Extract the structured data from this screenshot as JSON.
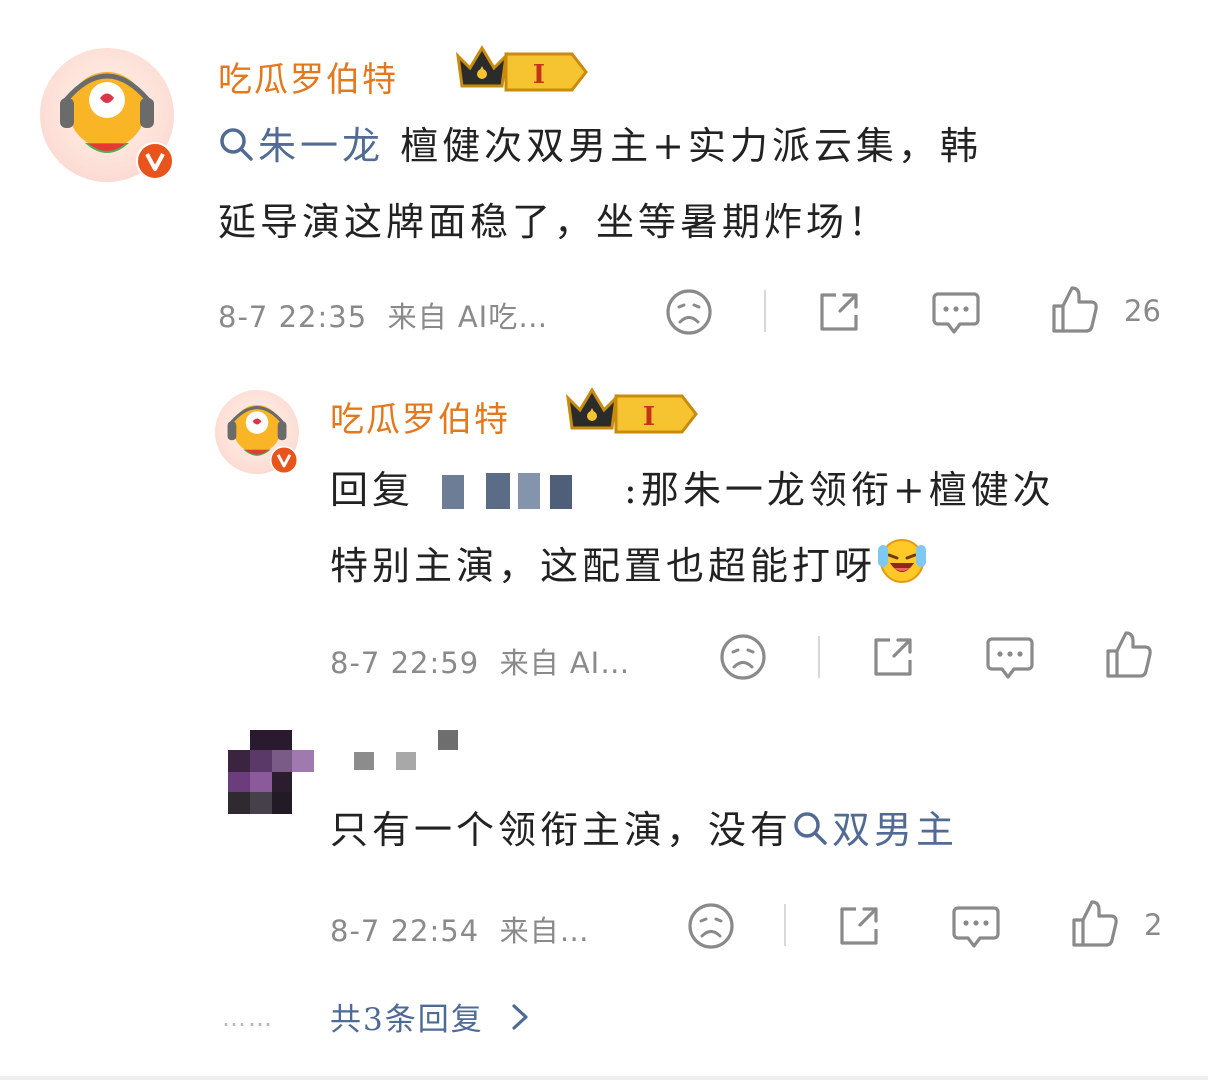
{
  "comment": {
    "username": "吃瓜罗伯特",
    "level": "I",
    "link_text": "朱一龙",
    "text_line1": " 檀健次双男主+实力派云集，韩",
    "text_line2": "延导演这牌面稳了，坐等暑期炸场！",
    "time": "8-7 22:35",
    "source": "来自 AI吃…",
    "likes": "26"
  },
  "replies": [
    {
      "username": "吃瓜罗伯特",
      "level": "I",
      "prefix": "回复",
      "text_line1": ":那朱一龙领衔+檀健次",
      "text_line2": "特别主演，这配置也超能打呀",
      "time": "8-7 22:59",
      "source": "来自 AI…",
      "likes": ""
    },
    {
      "username": "",
      "text_main": "只有一个领衔主演，没有",
      "link_text": "双男主",
      "time": "8-7 22:54",
      "source": "来自…",
      "likes": "2"
    }
  ],
  "more_replies": {
    "dots": "……",
    "label": "共3条回复"
  },
  "icons": {
    "search": "search-icon",
    "dislike": "sad-face-icon",
    "share": "share-icon",
    "comment": "comment-bubble-icon",
    "like": "thumbs-up-icon",
    "chevron": "chevron-right-icon",
    "verified": "verified-v-icon",
    "crown": "crown-icon",
    "emoji": "laugh-cry-emoji"
  },
  "colors": {
    "username": "#e4781d",
    "link": "#526b94",
    "meta": "#8a8a8a",
    "verified": "#e8541b",
    "badge_gold": "#f6c431"
  }
}
